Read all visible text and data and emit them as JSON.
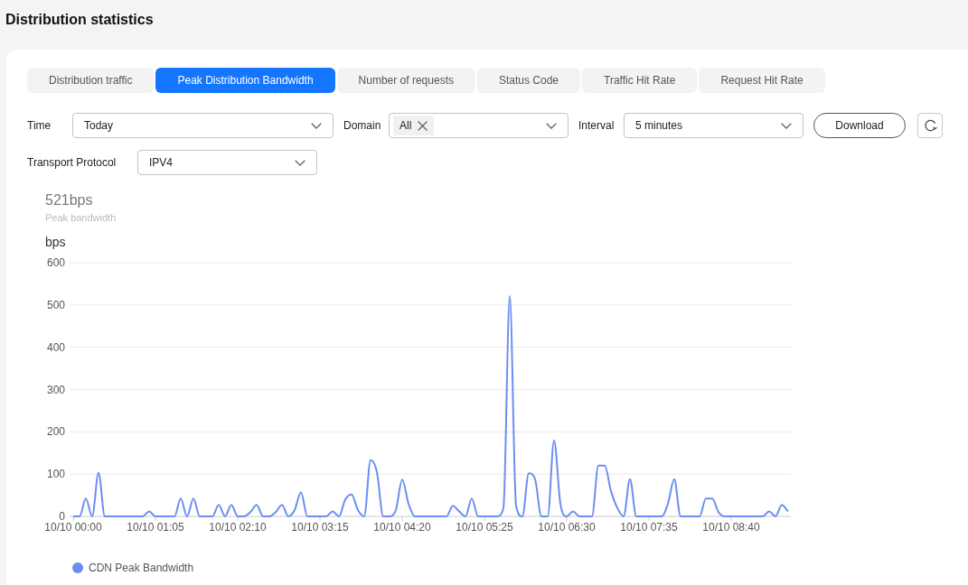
{
  "page": {
    "title": "Distribution statistics"
  },
  "tabs": [
    {
      "label": "Distribution traffic",
      "selected": false
    },
    {
      "label": "Peak Distribution Bandwidth",
      "selected": true
    },
    {
      "label": "Number of requests",
      "selected": false
    },
    {
      "label": "Status Code",
      "selected": false
    },
    {
      "label": "Traffic Hit Rate",
      "selected": false
    },
    {
      "label": "Request Hit Rate",
      "selected": false
    }
  ],
  "filter_rows": [
    {
      "items": [
        {
          "kind": "select",
          "label": "Time",
          "value": "Today"
        },
        {
          "kind": "tags",
          "label": "Domain",
          "tags": [
            "All"
          ]
        },
        {
          "kind": "select",
          "label": "Interval",
          "value": "5 minutes"
        },
        {
          "kind": "button",
          "text": "Download"
        },
        {
          "kind": "icon_button"
        }
      ]
    },
    {
      "items": [
        {
          "kind": "select",
          "label": "Transport Protocol",
          "value": "IPV4"
        }
      ]
    }
  ],
  "chart": {
    "summary": {
      "value": "521bps",
      "label": "Peak bandwidth"
    },
    "chart_data": {
      "type": "line",
      "ylabel": "bps",
      "ylim": [
        0,
        600
      ],
      "yticks": [
        0,
        100,
        200,
        300,
        400,
        500,
        600
      ],
      "grid": true,
      "categories": [
        "10/10 00:00",
        null,
        null,
        null,
        null,
        null,
        null,
        null,
        null,
        null,
        null,
        null,
        null,
        "10/10 01:05",
        null,
        null,
        null,
        null,
        null,
        null,
        null,
        null,
        null,
        null,
        null,
        null,
        "10/10 02:10",
        null,
        null,
        null,
        null,
        null,
        null,
        null,
        null,
        null,
        null,
        null,
        null,
        "10/10 03:15",
        null,
        null,
        null,
        null,
        null,
        null,
        null,
        null,
        null,
        null,
        null,
        null,
        "10/10 04:20",
        null,
        null,
        null,
        null,
        null,
        null,
        null,
        null,
        null,
        null,
        null,
        null,
        "10/10 05:25",
        null,
        null,
        null,
        null,
        null,
        null,
        null,
        null,
        null,
        null,
        null,
        null,
        "10/10 06:30",
        null,
        null,
        null,
        null,
        null,
        null,
        null,
        null,
        null,
        null,
        null,
        null,
        "10/10 07:35",
        null,
        null,
        null,
        null,
        null,
        null,
        null,
        null,
        null,
        null,
        null,
        null,
        "10/10 08:40",
        null,
        null,
        null,
        null,
        null,
        null,
        null,
        null,
        null
      ],
      "series": [
        {
          "name": "CDN Peak Bandwidth",
          "color": "#6b8ef0",
          "values": [
            0,
            0,
            42,
            0,
            103,
            0,
            0,
            0,
            0,
            0,
            0,
            0,
            12,
            0,
            0,
            0,
            0,
            42,
            0,
            42,
            0,
            0,
            0,
            27,
            0,
            27,
            0,
            0,
            10,
            27,
            0,
            0,
            10,
            27,
            0,
            15,
            57,
            0,
            0,
            0,
            0,
            12,
            0,
            40,
            52,
            15,
            0,
            133,
            105,
            0,
            0,
            15,
            87,
            30,
            0,
            0,
            0,
            0,
            0,
            0,
            25,
            12,
            0,
            42,
            0,
            0,
            0,
            0,
            20,
            521,
            25,
            0,
            102,
            88,
            0,
            0,
            180,
            30,
            0,
            12,
            0,
            0,
            0,
            120,
            120,
            60,
            20,
            0,
            88,
            0,
            0,
            0,
            0,
            0,
            30,
            88,
            0,
            0,
            0,
            0,
            42,
            42,
            10,
            0,
            0,
            0,
            0,
            0,
            0,
            0,
            12,
            0,
            27,
            12
          ]
        }
      ]
    }
  }
}
